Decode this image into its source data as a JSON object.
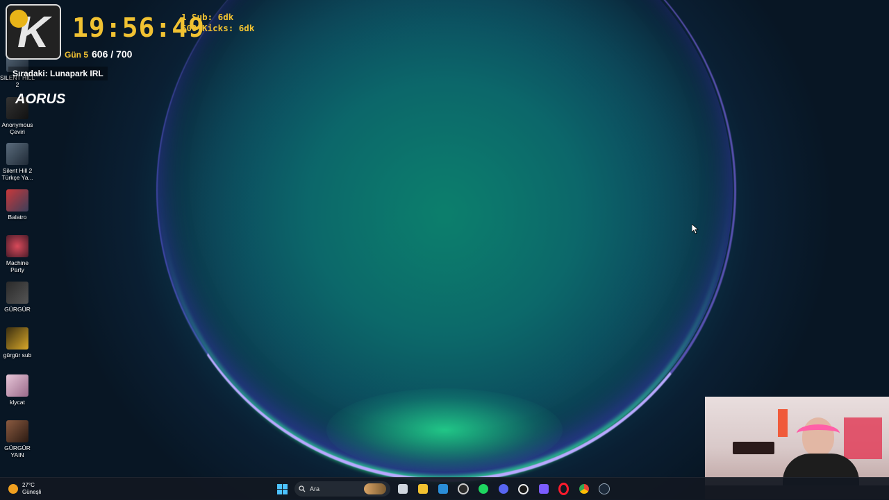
{
  "overlay": {
    "logo_letter": "K",
    "clock": "19:56:49",
    "goals": [
      "1 Sub: 6dk",
      "500 Kicks: 6dk"
    ],
    "day_label": "Gün 5",
    "day_count": "606 / 700",
    "next_up": "Sıradaki: Lunapark IRL",
    "brand": "AORUS"
  },
  "desktop_icons": [
    {
      "label": "SILENT HILL 2",
      "icon": "silent-hill-2-icon"
    },
    {
      "label": "Anonymous Çeviri",
      "icon": "anonymous-ceviri-icon"
    },
    {
      "label": "Silent Hill 2 Türkçe Ya...",
      "icon": "silent-hill-2-turkce-icon"
    },
    {
      "label": "Balatro",
      "icon": "balatro-icon"
    },
    {
      "label": "Machine Party",
      "icon": "machine-party-icon"
    },
    {
      "label": "GÜRGÜR",
      "icon": "gurgur-icon"
    },
    {
      "label": "gürgür sub",
      "icon": "gurgur-sub-icon"
    },
    {
      "label": "klycat",
      "icon": "klycat-icon"
    },
    {
      "label": "GÜRGÜR YAIN",
      "icon": "gurgur-yain-icon"
    }
  ],
  "taskbar": {
    "weather_temp": "27°C",
    "weather_desc": "Güneşli",
    "search_placeholder": "Ara",
    "apps": [
      "task-view",
      "file-explorer",
      "outlook",
      "obs",
      "spotify",
      "discord",
      "g-hub",
      "app-grid",
      "opera-gx",
      "chrome",
      "steam"
    ]
  }
}
